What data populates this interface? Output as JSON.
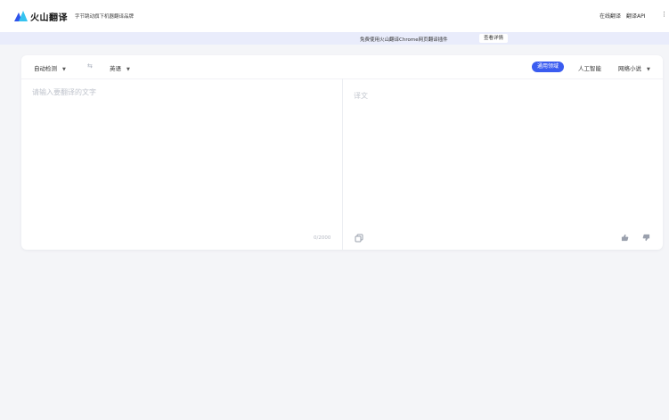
{
  "header": {
    "brand": "火山翻译",
    "slogan": "字节跳动旗下机器翻译品牌",
    "nav": [
      "在线翻译",
      "翻译API"
    ],
    "more_icon": "more-icon"
  },
  "banner": {
    "text": "免费使用火山翻译Chrome网页翻译插件",
    "button": "查看详情"
  },
  "translator": {
    "source_lang": "自动检测",
    "target_lang": "英语",
    "domains": [
      "通用领域",
      "人工智能",
      "网络小说"
    ],
    "placeholder": "请输入要翻译的文字",
    "char_count": "0/2000",
    "output_placeholder": "译文"
  },
  "colors": {
    "accent": "#3a5cf0",
    "banner_bg": "#e9ecfb",
    "page_bg": "#f4f5f8"
  },
  "icons": [
    "logo-icon",
    "swap-icon",
    "copy-icon",
    "like-icon",
    "dislike-icon",
    "chevron-down-icon"
  ]
}
